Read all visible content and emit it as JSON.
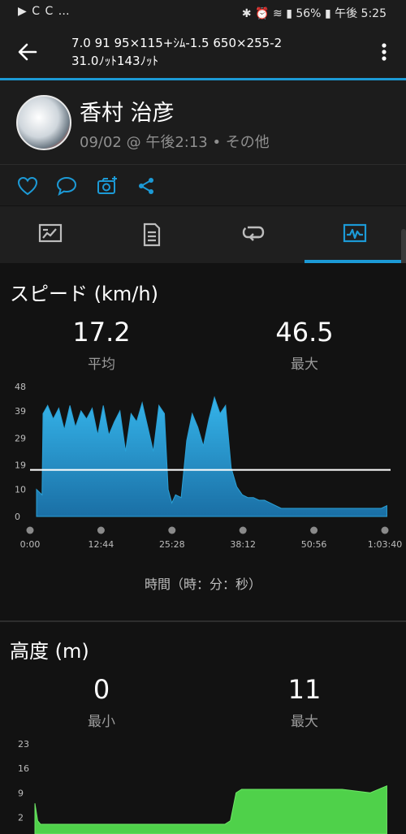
{
  "status_bar": {
    "left_icons": "▶ C C …",
    "battery": "56%",
    "time": "午後 5:25"
  },
  "app_bar": {
    "title_line1": "7.0 91 95×115+ｼﾑ-1.5 650×255-2",
    "title_line2": "31.0ﾉｯﾄ143ﾉｯﾄ"
  },
  "profile": {
    "name": "香村 治彦",
    "meta": "09/02 @ 午後2:13 • その他"
  },
  "speed": {
    "title": "スピード (km/h)",
    "avg_value": "17.2",
    "avg_label": "平均",
    "max_value": "46.5",
    "max_label": "最大",
    "x_caption": "時間（時：分：秒）"
  },
  "altitude": {
    "title": "高度 (m)",
    "min_value": "0",
    "min_label": "最小",
    "max_value": "11",
    "max_label": "最大"
  },
  "colors": {
    "accent": "#1c9ad6",
    "speed_fill": "#2aa0d6",
    "altitude_fill": "#4fd14a"
  },
  "chart_data": [
    {
      "type": "area",
      "title": "スピード (km/h)",
      "xlabel": "時間（時：分：秒）",
      "ylabel": "",
      "x_ticks": [
        "0:00",
        "12:44",
        "25:28",
        "38:12",
        "50:56",
        "1:03:40"
      ],
      "y_ticks": [
        0,
        10,
        19,
        29,
        39,
        48
      ],
      "ylim": [
        0,
        48
      ],
      "xlim_seconds": [
        0,
        3820
      ],
      "average_line": 17.2,
      "series": [
        {
          "x_seconds": [
            0,
            60,
            70,
            120,
            180,
            240,
            300,
            360,
            420,
            480,
            540,
            600,
            660,
            720,
            780,
            840,
            900,
            960,
            1020,
            1080,
            1140,
            1200,
            1260,
            1320,
            1380,
            1420,
            1460,
            1500,
            1560,
            1620,
            1680,
            1740,
            1800,
            1860,
            1920,
            1980,
            2040,
            2100,
            2160,
            2220,
            2280,
            2340,
            2400,
            2460,
            2520,
            2580,
            2640,
            2700,
            2760,
            2880,
            3000,
            3120,
            3240,
            3360,
            3480,
            3600,
            3720,
            3780
          ],
          "values": [
            10,
            8,
            38,
            41,
            36,
            40,
            32,
            41,
            33,
            39,
            36,
            40,
            30,
            41,
            30,
            35,
            39,
            24,
            38,
            35,
            42,
            33,
            24,
            41,
            38,
            10,
            5,
            8,
            7,
            28,
            38,
            33,
            26,
            36,
            44,
            38,
            41,
            18,
            11,
            8,
            7,
            7,
            6,
            6,
            5,
            4,
            3,
            3,
            3,
            3,
            3,
            3,
            3,
            3,
            3,
            3,
            3,
            4
          ]
        }
      ]
    },
    {
      "type": "area",
      "title": "高度 (m)",
      "y_ticks": [
        2,
        9,
        16,
        23
      ],
      "ylim": [
        0,
        23
      ],
      "series": [
        {
          "x_seconds": [
            0,
            30,
            60,
            2040,
            2100,
            2160,
            2220,
            2400,
            2700,
            3000,
            3300,
            3600,
            3780
          ],
          "values": [
            6,
            1,
            0,
            0,
            1,
            9,
            10,
            10,
            10,
            10,
            10,
            9,
            11
          ]
        }
      ]
    }
  ]
}
